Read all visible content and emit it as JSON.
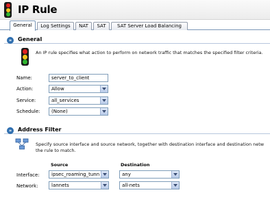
{
  "title": "IP Rule",
  "tabs": [
    "General",
    "Log Settings",
    "NAT",
    "SAT",
    "SAT Server Load Balancing"
  ],
  "general": {
    "heading": "General",
    "description": "An IP rule specifies what action to perform on network traffic that matches the specified filter criteria.",
    "fields": {
      "name": {
        "label": "Name:",
        "value": "server_to_client"
      },
      "action": {
        "label": "Action:",
        "value": "Allow"
      },
      "service": {
        "label": "Service:",
        "value": "all_services"
      },
      "schedule": {
        "label": "Schedule:",
        "value": "(None)"
      }
    }
  },
  "address_filter": {
    "heading": "Address Filter",
    "description_line1": "Specify source interface and source network, together with destination interface and destination netw",
    "description_line2": "the rule to match.",
    "source_header": "Source",
    "destination_header": "Destination",
    "interface": {
      "label": "Interface:",
      "source": "ipsec_roaming_tunn",
      "destination": "any"
    },
    "network": {
      "label": "Network:",
      "source": "lannets",
      "destination": "all-nets"
    }
  },
  "icons": [
    "traffic-light-icon",
    "expand-icon",
    "network-icon"
  ]
}
